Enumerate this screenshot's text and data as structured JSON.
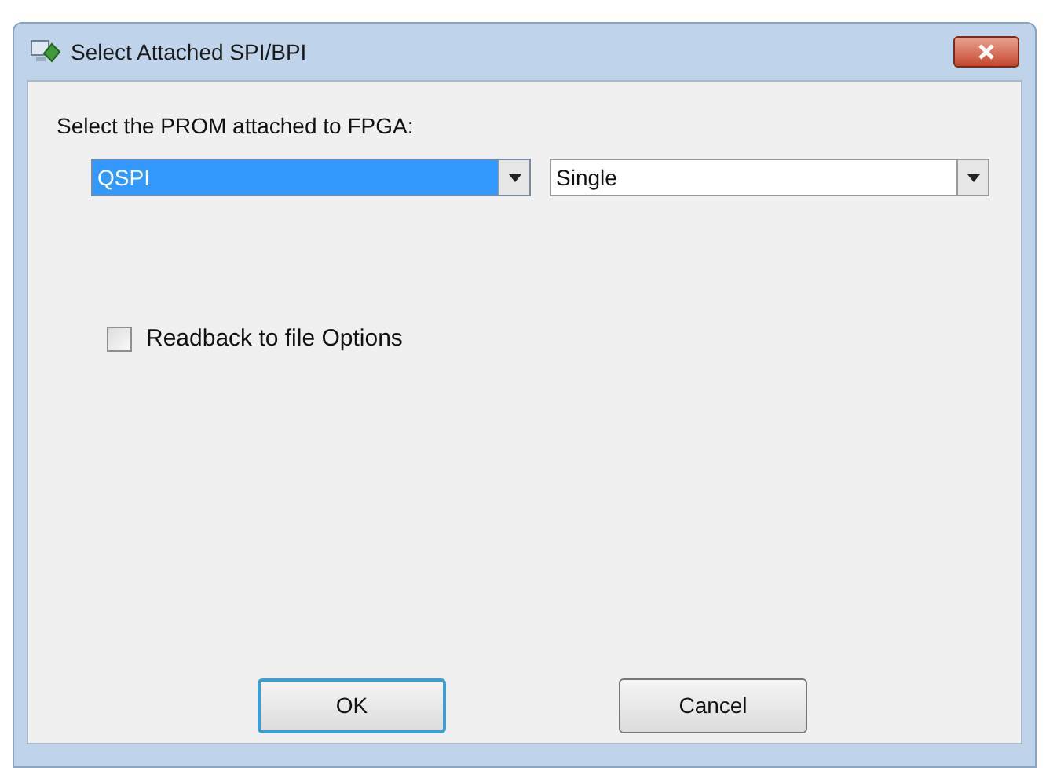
{
  "window": {
    "title": "Select Attached SPI/BPI"
  },
  "prompt": "Select the PROM attached to FPGA:",
  "dropdowns": [
    {
      "value": "QSPI",
      "selected": true
    },
    {
      "value": "Single",
      "selected": false
    }
  ],
  "checkbox": {
    "label": "Readback to file Options",
    "checked": false
  },
  "buttons": [
    {
      "label": "OK",
      "default": true
    },
    {
      "label": "Cancel",
      "default": false
    }
  ]
}
